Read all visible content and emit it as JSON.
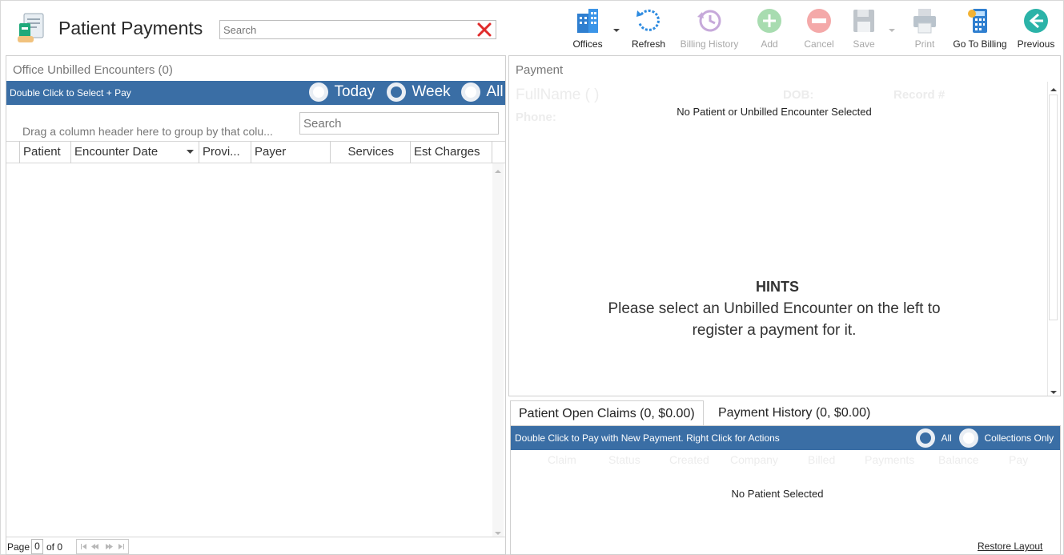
{
  "header": {
    "title": "Patient Payments",
    "search_placeholder": "Search",
    "app_icon": "payments-icon"
  },
  "toolbar": [
    {
      "label": "Offices",
      "icon": "offices-icon",
      "enabled": true,
      "has_dropdown": true
    },
    {
      "label": "Refresh",
      "icon": "refresh-icon",
      "enabled": true
    },
    {
      "label": "Billing History",
      "icon": "history-icon",
      "enabled": false
    },
    {
      "label": "Add",
      "icon": "add-icon",
      "enabled": false
    },
    {
      "label": "Cancel",
      "icon": "cancel-icon",
      "enabled": false
    },
    {
      "label": "Save",
      "icon": "save-icon",
      "enabled": false,
      "has_dropdown": true
    },
    {
      "label": "Print",
      "icon": "print-icon",
      "enabled": false
    },
    {
      "label": "Go To Billing",
      "icon": "billing-icon",
      "enabled": true
    },
    {
      "label": "Previous",
      "icon": "back-arrow-icon",
      "enabled": true
    }
  ],
  "left_panel": {
    "title": "Office Unbilled Encounters (0)",
    "bar_text": "Double Click to Select + Pay",
    "filters": [
      {
        "label": "Today",
        "selected": false
      },
      {
        "label": "Week",
        "selected": true
      },
      {
        "label": "All",
        "selected": false
      }
    ],
    "group_hint": "Drag a column header here to group by that colu...",
    "search_placeholder": "Search",
    "columns": [
      "Patient",
      "Encounter Date",
      "Provi...",
      "Payer",
      "Services",
      "Est Charges"
    ],
    "pager": {
      "page_label": "Page",
      "page_value": "0",
      "of_label": "of 0"
    }
  },
  "payment_panel": {
    "title": "Payment",
    "ghost_fullname": "FullName ( )",
    "ghost_dob": "DOB:",
    "ghost_record": "Record #",
    "ghost_phone": "Phone:",
    "no_selection": "No Patient or Unbilled Encounter Selected",
    "hints_title": "HINTS",
    "hints_line1": "Please select an Unbilled Encounter on the left to",
    "hints_line2": "register a payment for it."
  },
  "claims_panel": {
    "tabs": [
      {
        "label": "Patient Open Claims (0, $0.00)",
        "active": true
      },
      {
        "label": "Payment History (0, $0.00)",
        "active": false
      }
    ],
    "bar_text": "Double Click to Pay with New Payment. Right Click for Actions",
    "filters": [
      {
        "label": "All",
        "selected": true
      },
      {
        "label": "Collections Only",
        "selected": false
      }
    ],
    "columns": [
      "Claim",
      "Status",
      "Created",
      "Company",
      "Billed",
      "Payments",
      "Balance",
      "Pay"
    ],
    "empty_text": "No Patient Selected",
    "restore_layout": "Restore Layout"
  },
  "colors": {
    "accent_bar": "#3a6ea5",
    "close_red": "#e02b2b"
  }
}
